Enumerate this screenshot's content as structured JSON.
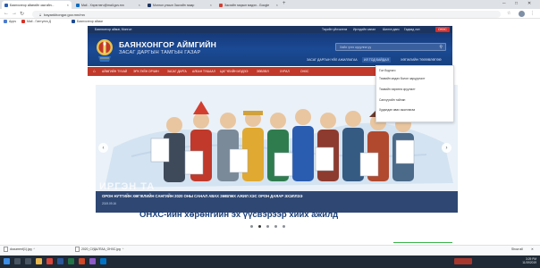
{
  "colors": {
    "site_header_blue": "#1b4a95",
    "main_nav_red": "#c0392b",
    "caption_navy": "#143060",
    "highlight_red": "#d32f2f",
    "progress_green": "#3bb54a"
  },
  "browser": {
    "tabs": [
      {
        "title": "Баянхонгор аймгийн засгийн...",
        "active": true,
        "color": "#2a5db0"
      },
      {
        "title": "Mail - Хэрэглэгч@mail.gov.mn",
        "active": false,
        "color": "#0f6cbd"
      },
      {
        "title": "Монгол улсын Засгийн газар",
        "active": false,
        "color": "#1c3560"
      },
      {
        "title": "Засгийн газрын мэдээ - Google",
        "active": false,
        "color": "#d23f31"
      }
    ],
    "new_tab_icon": "plus-icon",
    "window_controls": [
      "─",
      "□",
      "✕"
    ],
    "url": "bayankhongor.gov.mn/mn",
    "nav_icons": [
      "back-icon",
      "forward-icon",
      "reload-icon"
    ],
    "bookmarks": [
      {
        "label": "Apps",
        "color": "#4a7bd0"
      },
      {
        "label": "Mail - Гантулга Д",
        "color": "#d93025"
      },
      {
        "label": "Баянхонгор аймаг",
        "color": "#1b4a95"
      }
    ]
  },
  "site": {
    "top_bar": {
      "left": "Баянхонгор аймаг, Монгол",
      "links": [
        "Төрийн үйлчилгээ",
        "Иргэдийн санал",
        "Шилэн данс",
        "Гадаад хэл"
      ],
      "highlight": "ОНХС"
    },
    "brand": {
      "line1": "БАЯНХОНГОР АЙМГИЙН",
      "line2": "ЗАСАГ ДАРГЫН ТАМГЫН ГАЗАР"
    },
    "search": {
      "placeholder": "Хайх үгээ оруулна уу"
    },
    "sub_nav": [
      "ЗАСАГ ДАРГЫН ҮЙЛ АЖИЛЛАГАА",
      "ИЛ ТОД БАЙДАЛ",
      "ХӨГЖЛИЙН ТӨЛӨВЛӨГӨӨ"
    ],
    "main_nav": [
      "АЙМГИЙН ТУХАЙ",
      "ЭРХ ЗҮЙН ОРЧИН",
      "ЗАСАГ ДАРГА",
      "АЛБАН ТУШААЛ",
      "ЦАГ ҮЕИЙН МЭДЭЭ",
      "ЗӨВЛӨЛ",
      "ХУРАЛ",
      "ОНХС"
    ],
    "dropdown": [
      "Гол бодлого",
      "Төсвийн мэдээ болон зарцуулалт",
      "Төсвийн хөрөнгө оруулалт",
      "Санхүүгийн тайлан",
      "Худалдан авах ажиллагаа"
    ],
    "banner": {
      "overlay_word": "ИРГЭН ТА",
      "caption_title": "ОРОН НУТГИЙН ХӨГЖЛИЙН САНГИЙН 2020 ОНЫ САНАЛ АВАХ ЗӨВЛӨХ АЖИЛ ХЭС ОРОН ДАЯАР ЭХЭЛЛЭЭ",
      "caption_date": "2019.09.16",
      "headline": "ОНХС-ийн хөрөнгийн эх үүсвэрээр хийх ажилд",
      "slide_count": 5,
      "active_slide": 2,
      "prev_label": "‹",
      "next_label": "›"
    }
  },
  "downloads": {
    "items": [
      "document(1).jpg",
      "2020_СУДАЛГАА_ОНХС.jpg"
    ],
    "show_all": "Show all",
    "close": "✕"
  },
  "taskbar": {
    "time": "3:29 PM",
    "date": "11/19/2019",
    "apps": [
      "start-icon",
      "search-icon",
      "task-view-icon",
      "explorer-icon",
      "chrome-icon",
      "word-icon",
      "excel-icon",
      "powerpoint-icon",
      "paint-icon",
      "outlook-icon"
    ]
  }
}
